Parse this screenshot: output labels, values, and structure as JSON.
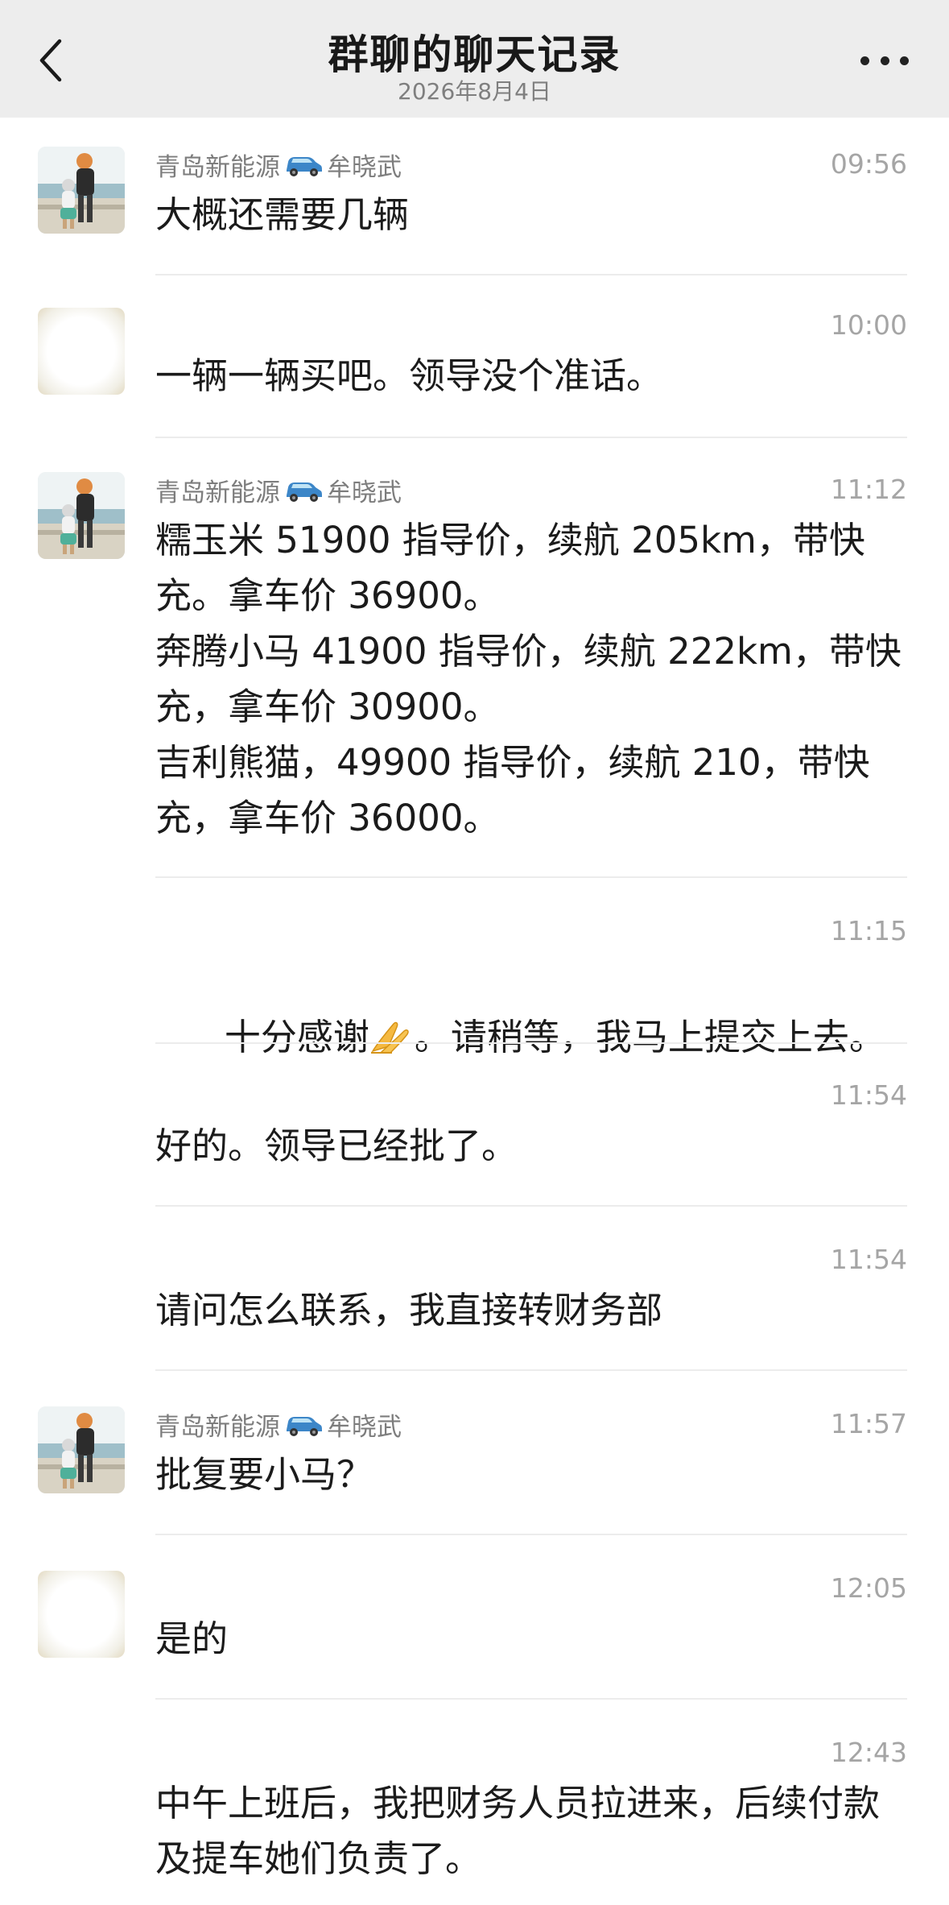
{
  "header": {
    "title": "群聊的聊天记录",
    "date": "2026年8月4日"
  },
  "messages": [
    {
      "sender": "青岛新能源",
      "sender_suffix": "牟晓武",
      "has_car_icon": true,
      "avatar": "photo-avatar",
      "time": "09:56",
      "text": "大概还需要几辆"
    },
    {
      "sender": "",
      "sender_suffix": "",
      "has_car_icon": false,
      "avatar": "blurred-avatar",
      "time": "10:00",
      "text": "一辆一辆买吧。领导没个准话。"
    },
    {
      "sender": "青岛新能源",
      "sender_suffix": "牟晓武",
      "has_car_icon": true,
      "avatar": "photo-avatar",
      "time": "11:12",
      "text": "糯玉米 51900 指导价，续航 205km，带快充。拿车价 36900。\n奔腾小马 41900 指导价，续航 222km，带快充，拿车价 30900。\n吉利熊猫，49900 指导价，续航 210，带快充，拿车价 36000。"
    },
    {
      "sender": "",
      "sender_suffix": "",
      "has_car_icon": false,
      "avatar": "none",
      "time": "11:15",
      "text_before": "十分感谢",
      "text_after": "。请稍等，我马上提交上去。"
    },
    {
      "sender": "",
      "sender_suffix": "",
      "has_car_icon": false,
      "avatar": "none",
      "time": "11:54",
      "text": "好的。领导已经批了。"
    },
    {
      "sender": "",
      "sender_suffix": "",
      "has_car_icon": false,
      "avatar": "none",
      "time": "11:54",
      "text": "请问怎么联系，我直接转财务部"
    },
    {
      "sender": "青岛新能源",
      "sender_suffix": "牟晓武",
      "has_car_icon": true,
      "avatar": "photo-avatar",
      "time": "11:57",
      "text": "批复要小马？"
    },
    {
      "sender": "",
      "sender_suffix": "",
      "has_car_icon": false,
      "avatar": "blurred-avatar",
      "time": "12:05",
      "text": "是的"
    },
    {
      "sender": "",
      "sender_suffix": "",
      "has_car_icon": false,
      "avatar": "none",
      "time": "12:43",
      "text": "中午上班后，我把财务人员拉进来，后续付款及提车她们负责了。"
    }
  ],
  "icons": {
    "back": "chevron-left-icon",
    "more": "more-horizontal-icon",
    "car": "blue-car-emoji",
    "hands": "praying-hands-emoji"
  },
  "colors": {
    "header_bg": "#ededed",
    "time": "#a5a5a5",
    "sender": "#7d7d7d",
    "text": "#1b1b1b",
    "divider": "#ececec"
  }
}
